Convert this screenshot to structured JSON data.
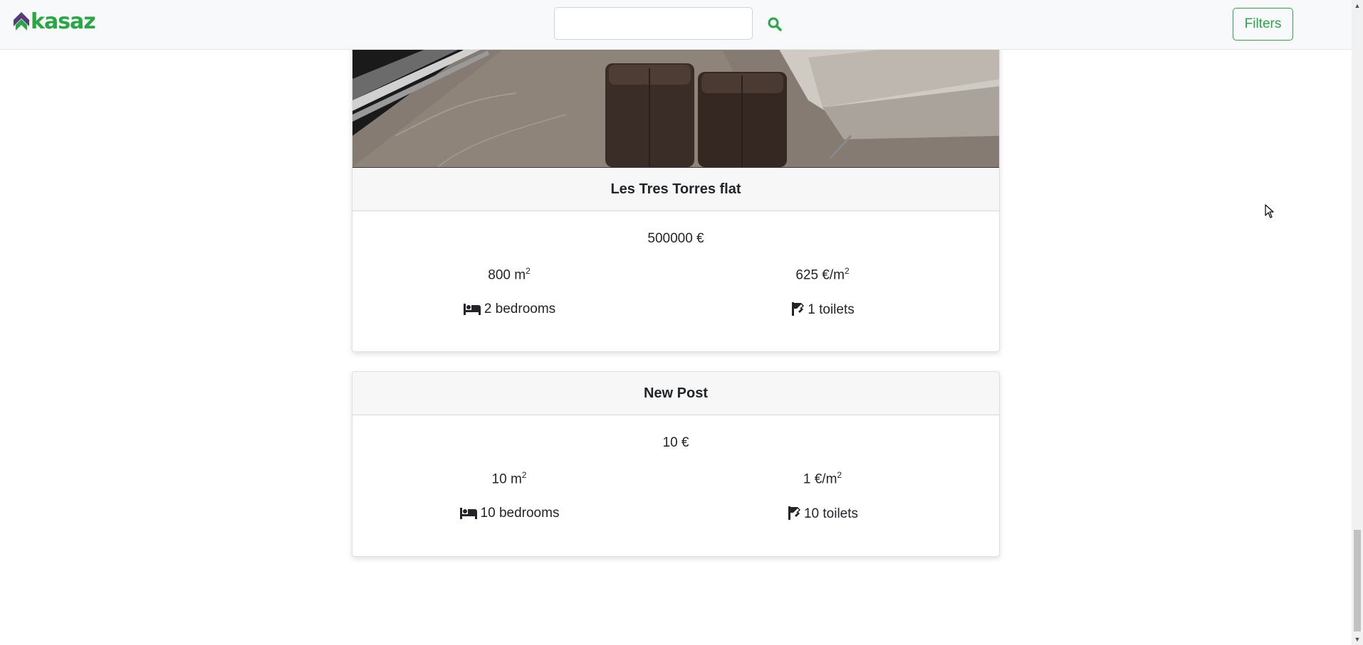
{
  "navbar": {
    "brand": "kasaz",
    "search": {
      "value": "",
      "placeholder": ""
    },
    "search_icon": "search-icon",
    "filters_label": "Filters"
  },
  "colors": {
    "accent": "#28a745",
    "brand_mark": "#5b3a7a"
  },
  "listings": [
    {
      "title": "Les Tres Torres flat",
      "price": "500000 €",
      "area_value": "800 m",
      "area_sup": "2",
      "price_per_m2_value": "625 €/m",
      "price_per_m2_sup": "2",
      "bedrooms": "2 bedrooms",
      "toilets": "1 toilets",
      "has_image": true
    },
    {
      "title": "New Post",
      "price": "10 €",
      "area_value": "10 m",
      "area_sup": "2",
      "price_per_m2_value": "1 €/m",
      "price_per_m2_sup": "2",
      "bedrooms": "10 bedrooms",
      "toilets": "10 toilets",
      "has_image": false
    }
  ],
  "icons": {
    "bed": "bed-icon",
    "toilet": "toilet-icon"
  }
}
